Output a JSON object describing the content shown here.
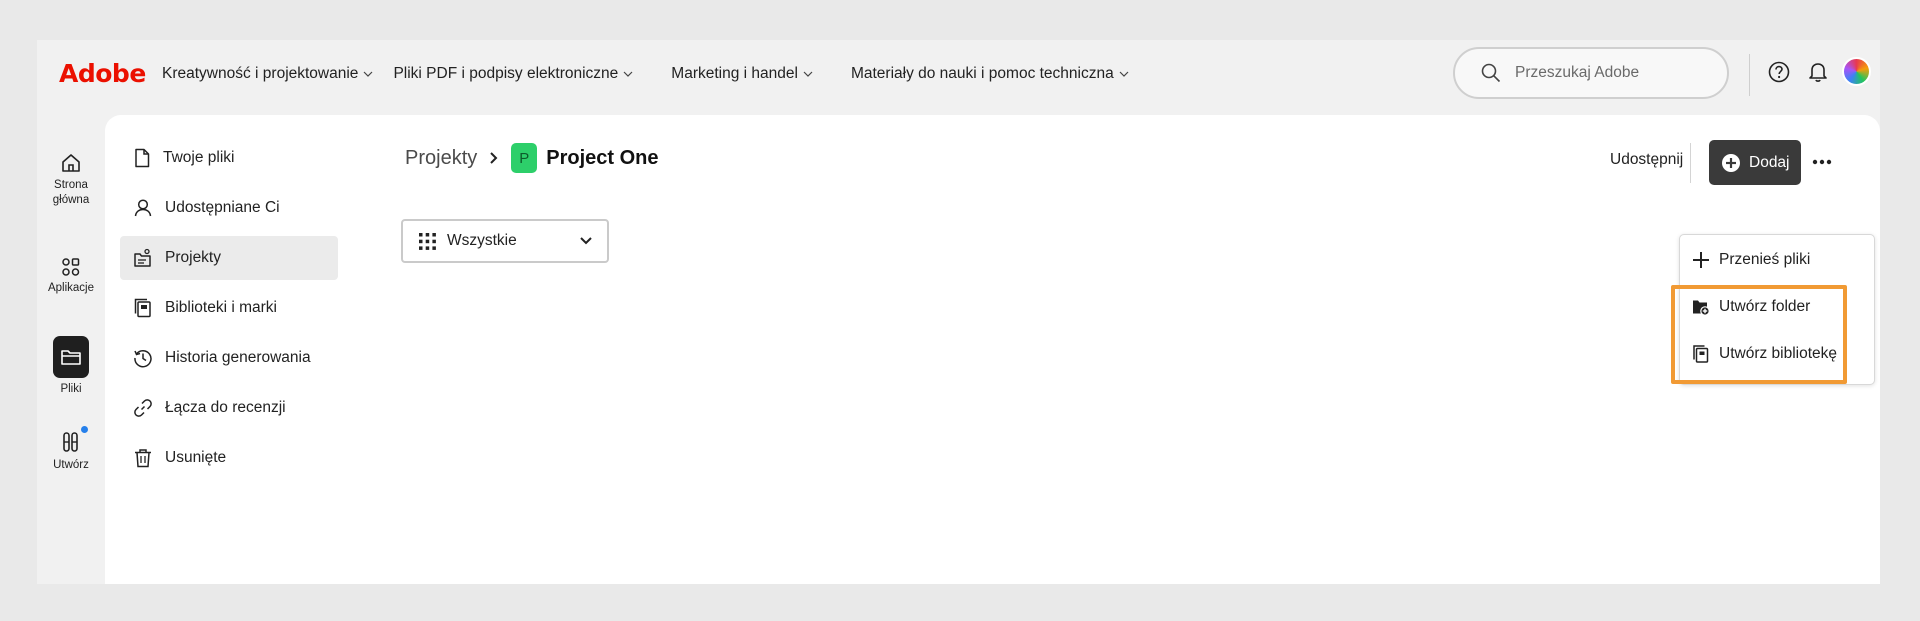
{
  "brand": {
    "logo": "Adobe",
    "logo_color": "#eb1000"
  },
  "topnav": [
    {
      "label": "Kreatywność i projektowanie"
    },
    {
      "label": "Pliki PDF i podpisy elektroniczne"
    },
    {
      "label": "Marketing i handel"
    },
    {
      "label": "Materiały do nauki i pomoc techniczna"
    }
  ],
  "search": {
    "placeholder": "Przeszukaj Adobe"
  },
  "top_icons": [
    "help-icon",
    "bell-icon",
    "avatar"
  ],
  "rail": [
    {
      "label_line1": "Strona",
      "label_line2": "główna",
      "icon": "home-icon"
    },
    {
      "label": "Aplikacje",
      "icon": "apps-icon"
    },
    {
      "label": "Pliki",
      "icon": "folder-icon",
      "active": true
    },
    {
      "label": "Utwórz",
      "icon": "create-icon",
      "badge": true
    }
  ],
  "sidebar": {
    "items": [
      {
        "label": "Twoje pliki",
        "icon": "file-icon"
      },
      {
        "label": "Udostępniane Ci",
        "icon": "shared-user-icon"
      },
      {
        "label": "Projekty",
        "icon": "projects-icon",
        "active": true
      },
      {
        "label": "Biblioteki i marki",
        "icon": "library-icon"
      },
      {
        "label": "Historia generowania",
        "icon": "history-icon"
      },
      {
        "label": "Łącza do recenzji",
        "icon": "link-icon"
      },
      {
        "label": "Usunięte",
        "icon": "trash-icon"
      }
    ]
  },
  "breadcrumb": {
    "parent": "Projekty",
    "badge": "P",
    "current": "Project One",
    "badge_color": "#2dcf6a"
  },
  "filter": {
    "selected": "Wszystkie"
  },
  "actions": {
    "share_label": "Udostępnij",
    "add_label": "Dodaj"
  },
  "add_menu": {
    "items": [
      {
        "label": "Przenieś pliki",
        "icon": "plus-icon"
      },
      {
        "label": "Utwórz folder",
        "icon": "new-folder-icon"
      },
      {
        "label": "Utwórz bibliotekę",
        "icon": "new-library-icon"
      }
    ],
    "highlight_color": "#f19a34"
  }
}
